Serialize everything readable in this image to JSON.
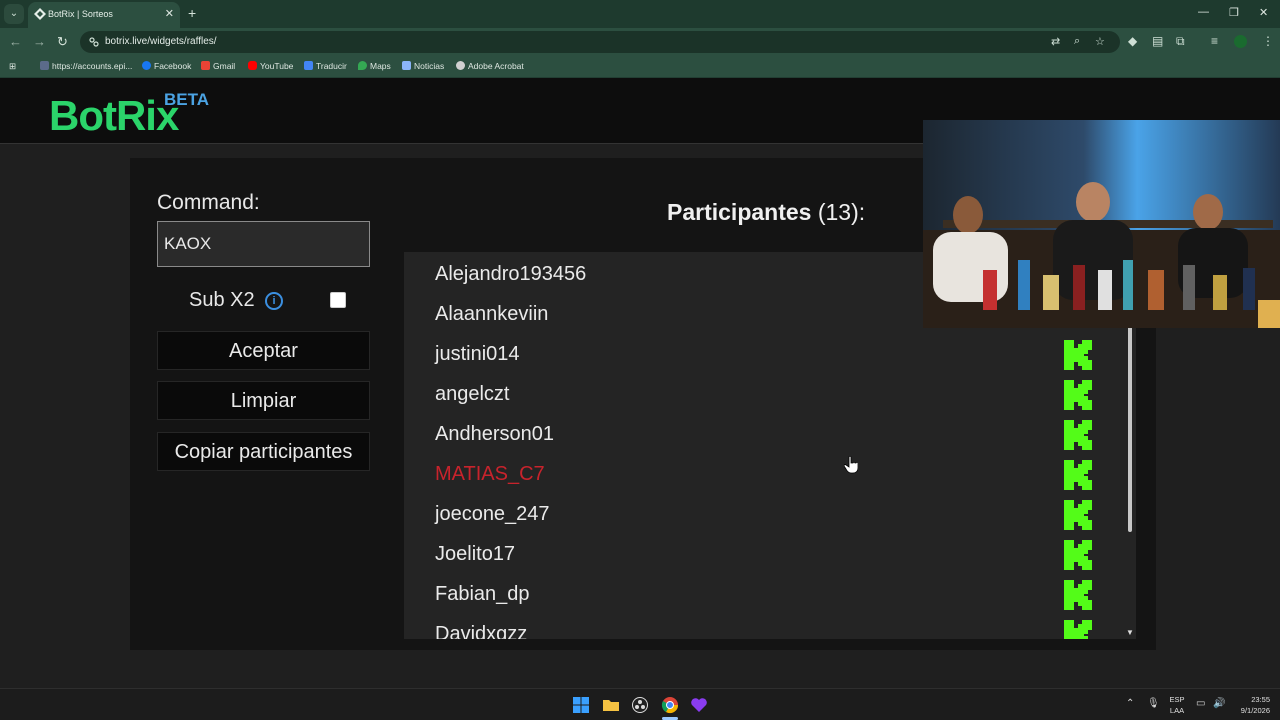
{
  "browser": {
    "tab_title": "BotRix | Sorteos",
    "url": "botrix.live/widgets/raffles/",
    "bookmarks": [
      {
        "label": "https://accounts.epi...",
        "color": "#5b6b8a"
      },
      {
        "label": "Facebook",
        "color": "#1877f2"
      },
      {
        "label": "Gmail",
        "color": "#ea4335"
      },
      {
        "label": "YouTube",
        "color": "#ff0000"
      },
      {
        "label": "Traducir",
        "color": "#4285f4"
      },
      {
        "label": "Maps",
        "color": "#34a853"
      },
      {
        "label": "Noticias",
        "color": "#8ab4f8"
      },
      {
        "label": "Adobe Acrobat",
        "color": "#d0d0d0"
      }
    ]
  },
  "header": {
    "logo": "BotRix",
    "beta": "BETA"
  },
  "form": {
    "command_label": "Command:",
    "command_value": "KAOX",
    "sub_label": "Sub X2",
    "buttons": {
      "accept": "Aceptar",
      "clear": "Limpiar",
      "copy": "Copiar participantes"
    }
  },
  "participants": {
    "title": "Participantes",
    "count": "(13):",
    "items": [
      {
        "name": "Alejandro193456",
        "highlight": false,
        "kick_badge": false
      },
      {
        "name": "Alaannkeviin",
        "highlight": false,
        "kick_badge": false
      },
      {
        "name": "justini014",
        "highlight": false,
        "kick_badge": true
      },
      {
        "name": "angelczt",
        "highlight": false,
        "kick_badge": true
      },
      {
        "name": "Andherson01",
        "highlight": false,
        "kick_badge": true
      },
      {
        "name": "MATIAS_C7",
        "highlight": true,
        "kick_badge": true
      },
      {
        "name": "joecone_247",
        "highlight": false,
        "kick_badge": true
      },
      {
        "name": "Joelito17",
        "highlight": false,
        "kick_badge": true
      },
      {
        "name": "Fabian_dp",
        "highlight": false,
        "kick_badge": true
      },
      {
        "name": "Davidxgzz",
        "highlight": false,
        "kick_badge": true
      }
    ]
  },
  "taskbar": {
    "lang": "ESP",
    "layout": "LAA",
    "time": "23:55",
    "date": "9/1/2026"
  },
  "colors": {
    "accent_green": "#2bd46a",
    "beta_blue": "#4ba3e3",
    "kick_green": "#53fc18",
    "winner_red": "#c8232c"
  }
}
